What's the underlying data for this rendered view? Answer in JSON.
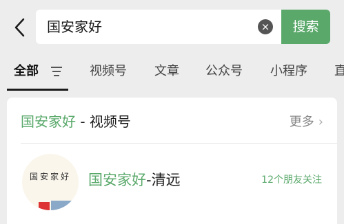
{
  "search": {
    "query": "国安家好",
    "button_label": "搜索",
    "icons": {
      "back": "chevron-left-icon",
      "clear": "clear-circle-icon"
    }
  },
  "tabs": [
    {
      "label": "全部",
      "active": true
    },
    {
      "label": "视频号",
      "active": false
    },
    {
      "label": "文章",
      "active": false
    },
    {
      "label": "公众号",
      "active": false
    },
    {
      "label": "小程序",
      "active": false
    },
    {
      "label": "直",
      "active": false
    }
  ],
  "section": {
    "title_highlight": "国安家好",
    "title_rest": " - 视频号",
    "more_label": "更多",
    "result": {
      "avatar_text": "国安家好",
      "name_highlight": "国安家好",
      "name_rest": "-清远",
      "friends_label": "12个朋友关注"
    }
  },
  "colors": {
    "accent": "#5aa96b",
    "background": "#ededed"
  }
}
